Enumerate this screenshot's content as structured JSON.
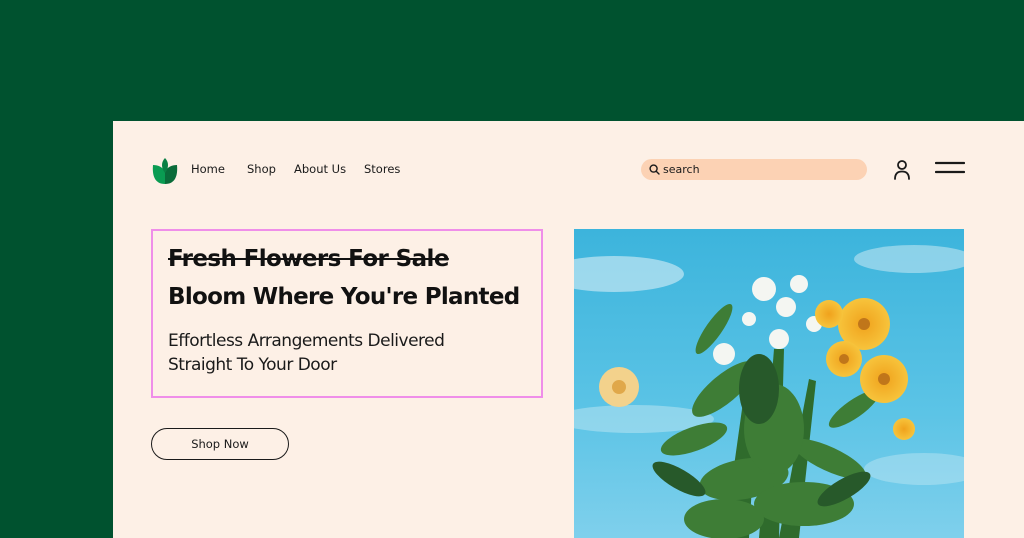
{
  "nav": {
    "logo_icon": "leaf-logo-icon",
    "items": [
      {
        "label": "Home"
      },
      {
        "label": "Shop"
      },
      {
        "label": "About Us"
      },
      {
        "label": "Stores"
      }
    ]
  },
  "search": {
    "placeholder": "search",
    "icon": "search-icon"
  },
  "header_icons": {
    "account": "user-icon",
    "menu": "hamburger-menu-icon"
  },
  "hero": {
    "strikethrough_title": "Fresh Flowers For Sale",
    "title": "Bloom Where You're Planted",
    "subtitle_line1": "Effortless Arrangements Delivered",
    "subtitle_line2": "Straight To Your Door"
  },
  "cta": {
    "shop_now_label": "Shop Now"
  },
  "colors": {
    "outer_background": "#00522f",
    "page_background": "#fdf0e6",
    "search_background": "#fcd2b4",
    "highlight_border": "#ef8ee9",
    "logo_green": "#0b8a4a",
    "text_dark": "#111111"
  }
}
